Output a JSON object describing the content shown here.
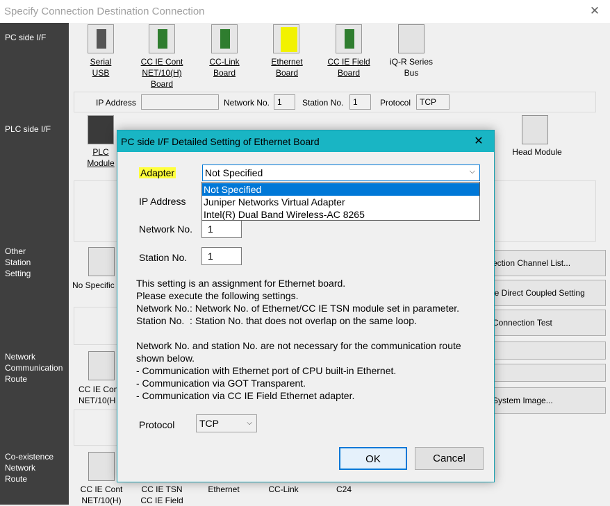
{
  "window": {
    "title": "Specify Connection Destination Connection",
    "close_glyph": "✕"
  },
  "sidebar": {
    "pc_side": "PC side I/F",
    "plc_side": "PLC side I/F",
    "other_station": "Other\nStation\nSetting",
    "network_route": "Network\nCommunication\nRoute",
    "coexistence": "Co-existence\nNetwork\nRoute"
  },
  "pc_side_icons": [
    {
      "name": "serial-usb",
      "label": "Serial\nUSB"
    },
    {
      "name": "cc-ie-cont-board",
      "label": "CC IE Cont\nNET/10(H)\nBoard"
    },
    {
      "name": "cc-link-board",
      "label": "CC-Link\nBoard"
    },
    {
      "name": "ethernet-board",
      "label": "Ethernet\nBoard"
    },
    {
      "name": "cc-ie-field-board",
      "label": "CC IE Field\nBoard"
    },
    {
      "name": "iq-r-series-bus",
      "label": "iQ-R Series\nBus"
    }
  ],
  "pc_panel": {
    "ip_label": "IP Address",
    "ip_value": "",
    "network_label": "Network No.",
    "network_value": "1",
    "station_label": "Station No.",
    "station_value": "1",
    "protocol_label": "Protocol",
    "protocol_value": "TCP"
  },
  "plc_icons": {
    "plc_module": "PLC\nModule",
    "head_module": "Head Module"
  },
  "other_station": {
    "no_specific": "No Specific"
  },
  "right_buttons": [
    "ection Channel List...",
    "le Direct Coupled Setting",
    "Connection Test",
    "",
    "",
    "System Image..."
  ],
  "network_route": {
    "icon_label": "CC IE Con\nNET/10(H"
  },
  "coexistence_labels": [
    "CC IE Cont\nNET/10(H)",
    "CC IE TSN\nCC IE Field",
    "Ethernet",
    "CC-Link",
    "C24"
  ],
  "dialog": {
    "title": "PC side I/F Detailed Setting of Ethernet Board",
    "close_glyph": "✕",
    "adapter_label": "Adapter",
    "adapter_value": "Not Specified",
    "adapter_options": [
      "Not Specified",
      "Juniper Networks Virtual Adapter",
      "Intel(R) Dual Band Wireless-AC 8265"
    ],
    "ip_label": "IP Address",
    "network_label": "Network No.",
    "network_value": "1",
    "station_label": "Station No.",
    "station_value": "1",
    "info_text": "This setting is an assignment for Ethernet board.\nPlease execute the following settings.\nNetwork No.: Network No. of Ethernet/CC IE TSN module set in parameter.\nStation No.  : Station No. that does not overlap on the same loop.\n\nNetwork No. and station No. are not necessary for the communication route\nshown below.\n- Communication with Ethernet port of CPU built-in Ethernet.\n- Communication via GOT Transparent.\n- Communication via CC IE Field Ethernet adapter.",
    "protocol_label": "Protocol",
    "protocol_value": "TCP",
    "ok_label": "OK",
    "cancel_label": "Cancel"
  }
}
